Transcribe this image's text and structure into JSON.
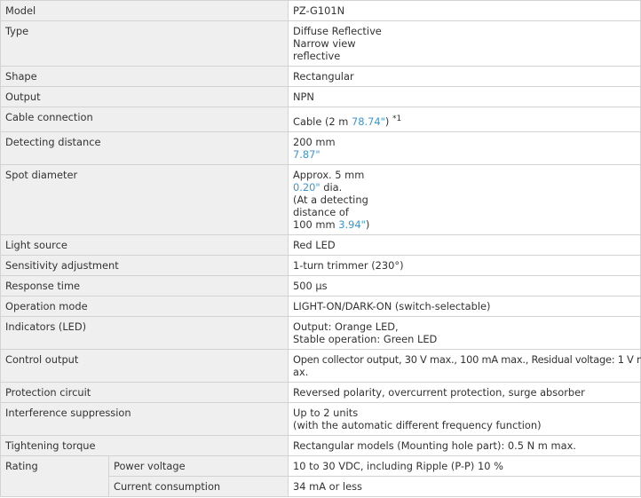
{
  "rows": {
    "model": {
      "label": "Model",
      "value": "PZ-G101N"
    },
    "type": {
      "label": "Type",
      "lines": [
        "Diffuse Reflective",
        "Narrow view",
        "reflective"
      ]
    },
    "shape": {
      "label": "Shape",
      "value": "Rectangular"
    },
    "output": {
      "label": "Output",
      "value": "NPN"
    },
    "cable": {
      "label": "Cable connection",
      "pre": "Cable (2 m ",
      "blue": "78.74\"",
      "post": ")",
      "note": "*1"
    },
    "detecting": {
      "label": "Detecting distance",
      "line1": "200 mm",
      "blue": "7.87\""
    },
    "spot": {
      "label": "Spot diameter",
      "line1": "Approx. 5 mm",
      "blue1": "0.20\"",
      "after_blue1": " dia.",
      "line3": "(At a detecting",
      "line4": "distance of",
      "line5_pre": "100 mm ",
      "blue2": "3.94\"",
      "line5_post": ")"
    },
    "light": {
      "label": "Light source",
      "value": "Red LED"
    },
    "sensitivity": {
      "label": "Sensitivity adjustment",
      "value": "1-turn trimmer (230°)"
    },
    "response": {
      "label": "Response time",
      "value": "500 µs"
    },
    "operation": {
      "label": "Operation mode",
      "value": "LIGHT-ON/DARK-ON (switch-selectable)"
    },
    "indicators": {
      "label": "Indicators (LED)",
      "lines": [
        "Output: Orange LED,",
        "Stable operation: Green LED"
      ]
    },
    "control": {
      "label": "Control output",
      "lines": [
        "Open collector output, 30 V max., 100 mA max., Residual voltage: 1 V m",
        "ax."
      ]
    },
    "protection": {
      "label": "Protection circuit",
      "value": "Reversed polarity, overcurrent protection, surge absorber"
    },
    "interference": {
      "label": "Interference suppression",
      "lines": [
        "Up to 2 units",
        "(with the automatic different frequency function)"
      ]
    },
    "torque": {
      "label": "Tightening torque",
      "value": "Rectangular models (Mounting hole part): 0.5 N m max."
    },
    "rating": {
      "label": "Rating",
      "power": {
        "label": "Power voltage",
        "value": "10 to 30 VDC, including Ripple (P-P) 10 %"
      },
      "current": {
        "label": "Current consumption",
        "value": "34 mA or less"
      }
    }
  }
}
